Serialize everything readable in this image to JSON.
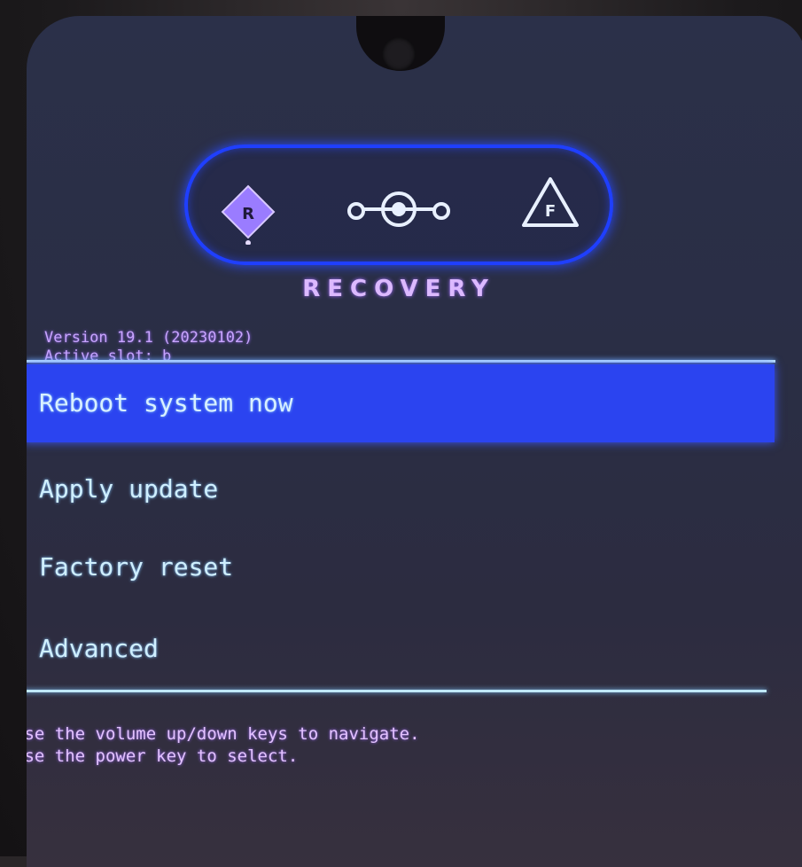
{
  "recovery": {
    "title": "RECOVERY",
    "version": "Version 19.1 (20230102)",
    "active_slot": "Active slot: b",
    "mode_icons": {
      "left": "R",
      "center": "lineage-logo",
      "right": "F"
    },
    "menu": [
      {
        "label": "Reboot system now",
        "selected": true
      },
      {
        "label": "Apply update",
        "selected": false
      },
      {
        "label": "Factory reset",
        "selected": false
      },
      {
        "label": "Advanced",
        "selected": false
      }
    ],
    "help_lines": [
      "Use the volume up/down keys to navigate.",
      "Use the power key to select."
    ]
  },
  "colors": {
    "accent_blue": "#2b44f0",
    "title_violet": "#dcb9ff",
    "menu_text": "#cfefff",
    "divider": "#bfe8ff"
  }
}
